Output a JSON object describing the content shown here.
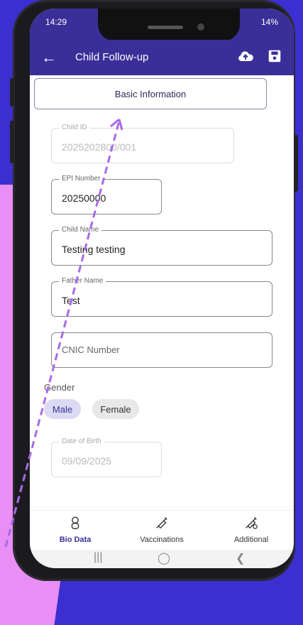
{
  "status": {
    "time": "14:29",
    "battery": "14%"
  },
  "appbar": {
    "title": "Child Follow-up"
  },
  "section": {
    "basic_info": "Basic Information"
  },
  "fields": {
    "child_id": {
      "label": "Child ID",
      "value": "2025202800/001"
    },
    "epi_number": {
      "label": "EPI Number",
      "value": "20250000"
    },
    "child_name": {
      "label": "Child Name",
      "value": "Testing testing"
    },
    "father_name": {
      "label": "Father Name",
      "value": "Test"
    },
    "cnic": {
      "placeholder": "CNIC Number"
    },
    "dob": {
      "label": "Date of Birth",
      "value": "09/09/2025"
    }
  },
  "gender": {
    "label": "Gender",
    "male": "Male",
    "female": "Female",
    "selected": "Male"
  },
  "bottomnav": {
    "bio": "Bio Data",
    "vacc": "Vaccinations",
    "additional": "Additional"
  },
  "colors": {
    "primary": "#3a2f98",
    "arrow": "#a86ae8",
    "background": "#3b2fcf",
    "accent_pink": "#e88ef5"
  },
  "icons": [
    "arrow-back-icon",
    "cloud-upload-icon",
    "save-icon",
    "baby-icon",
    "syringe-icon",
    "syringe-settings-icon"
  ]
}
